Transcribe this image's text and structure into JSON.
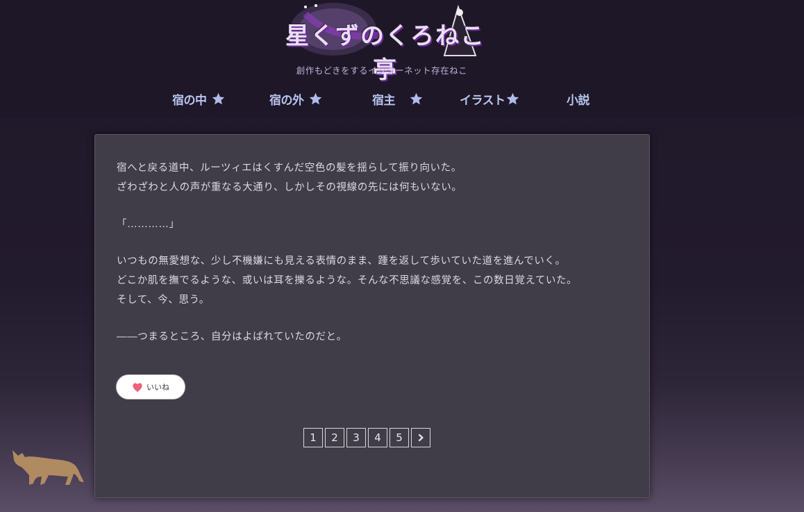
{
  "header": {
    "logo_text": "星くずのくろねこ亭",
    "tagline": "創作もどきをするインターネット存在ねこ"
  },
  "nav": {
    "items": [
      {
        "label": "宿の中",
        "has_star": true
      },
      {
        "label": "宿の外",
        "has_star": true
      },
      {
        "label": "宿主",
        "has_star": true
      },
      {
        "label": "イラスト",
        "has_star": true
      },
      {
        "label": "小説",
        "has_star": false
      }
    ]
  },
  "story": {
    "lines": [
      "宿へと戻る道中、ルーツィエはくすんだ空色の髪を揺らして振り向いた。",
      "ざわざわと人の声が重なる大通り、しかしその視線の先には何もいない。",
      "「…………」",
      "いつもの無愛想な、少し不機嫌にも見える表情のまま、踵を返して歩いていた道を進んでいく。",
      "どこか肌を撫でるような、或いは耳を擽るような。そんな不思議な感覚を、この数日覚えていた。",
      "そして、今、思う。",
      "――つまるところ、自分はよばれていたのだと。"
    ]
  },
  "like": {
    "label": "いいね",
    "heart_color": "#f0607a"
  },
  "pager": {
    "pages": [
      "1",
      "2",
      "3",
      "4",
      "5"
    ],
    "next_icon": "chevron-right-icon"
  },
  "colors": {
    "nav_text": "#b8c4ee",
    "star": "#aebde9",
    "card_bg": "#403d49",
    "cat": "#b08a60"
  }
}
